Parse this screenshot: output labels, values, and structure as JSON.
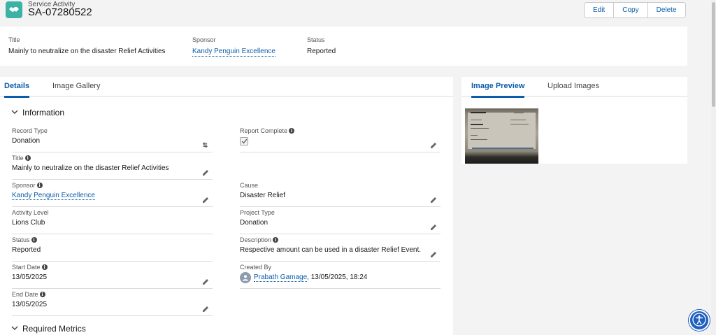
{
  "header": {
    "object_type": "Service Activity",
    "record_name": "SA-07280522",
    "actions": {
      "edit": "Edit",
      "copy": "Copy",
      "delete": "Delete"
    }
  },
  "highlights": {
    "title_label": "Title",
    "title_value": "Mainly to neutralize on the disaster Relief Activities",
    "sponsor_label": "Sponsor",
    "sponsor_value": "Kandy Penguin Excellence",
    "status_label": "Status",
    "status_value": "Reported"
  },
  "main_tabs": {
    "details": "Details",
    "gallery": "Image Gallery"
  },
  "sections": {
    "information": "Information",
    "required_metrics": "Required Metrics"
  },
  "fields": {
    "record_type": {
      "label": "Record Type",
      "value": "Donation"
    },
    "report_complete": {
      "label": "Report Complete",
      "checked": true
    },
    "title": {
      "label": "Title",
      "value": "Mainly to neutralize on the disaster Relief Activities"
    },
    "sponsor": {
      "label": "Sponsor",
      "value": "Kandy Penguin Excellence"
    },
    "cause": {
      "label": "Cause",
      "value": "Disaster Relief"
    },
    "activity_level": {
      "label": "Activity Level",
      "value": "Lions Club"
    },
    "project_type": {
      "label": "Project Type",
      "value": "Donation"
    },
    "status": {
      "label": "Status",
      "value": "Reported"
    },
    "description": {
      "label": "Description",
      "value": "Respective amount can be used in a disaster Relief Event."
    },
    "start_date": {
      "label": "Start Date",
      "value": "13/05/2025"
    },
    "created_by": {
      "label": "Created By",
      "user": "Prabath Gamage",
      "timestamp": ", 13/05/2025, 18:24"
    },
    "end_date": {
      "label": "End Date",
      "value": "13/05/2025"
    }
  },
  "side_tabs": {
    "preview": "Image Preview",
    "upload": "Upload Images"
  },
  "colors": {
    "brand": "#0b5cab",
    "icon_teal": "#3bb3a4",
    "a11y": "#1f5fbf"
  }
}
